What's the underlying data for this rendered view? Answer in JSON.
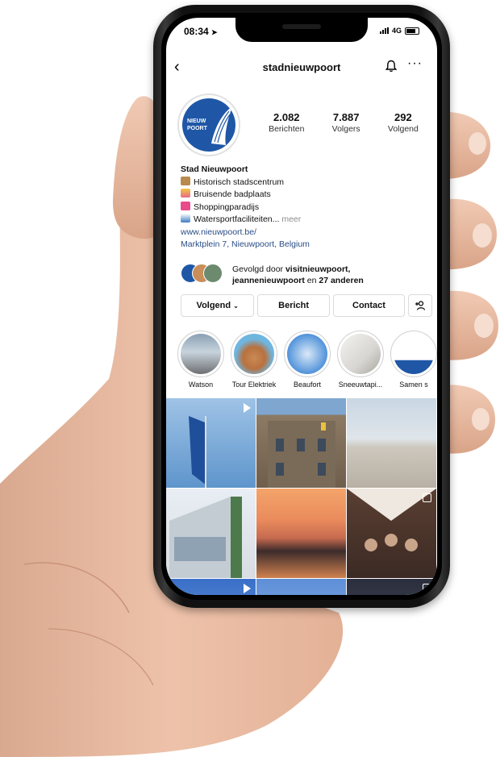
{
  "status": {
    "time": "08:34",
    "network": "4G"
  },
  "header": {
    "username": "stadnieuwpoort"
  },
  "avatar": {
    "text_line1": "NIEUW",
    "text_line2": "POORT"
  },
  "stats": [
    {
      "value": "2.082",
      "label": "Berichten"
    },
    {
      "value": "7.887",
      "label": "Volgers"
    },
    {
      "value": "292",
      "label": "Volgend"
    }
  ],
  "bio": {
    "name": "Stad Nieuwpoort",
    "line1": "Historisch stadscentrum",
    "line2": "Bruisende badplaats",
    "line3": "Shoppingparadijs",
    "line4": "Watersportfaciliteiten...",
    "more": "meer",
    "website": "www.nieuwpoort.be/",
    "address": "Marktplein 7, Nieuwpoort, Belgium"
  },
  "followed_by": {
    "prefix": "Gevolgd door",
    "account1": "visitnieuwpoort,",
    "account2": "jeannenieuwpoort",
    "middle": "en",
    "others": "27 anderen"
  },
  "buttons": {
    "following": "Volgend",
    "message": "Bericht",
    "contact": "Contact"
  },
  "highlights": [
    {
      "label": "Watson"
    },
    {
      "label": "Tour Elektriek"
    },
    {
      "label": "Beaufort"
    },
    {
      "label": "Sneeuwtapi..."
    },
    {
      "label": "Samen s"
    }
  ],
  "icons": {
    "back": "chevron-left-icon",
    "bell": "bell-icon",
    "more": "more-horizontal-icon",
    "add_person": "add-person-icon",
    "play": "play-icon",
    "carousel": "carousel-icon"
  },
  "colors": {
    "brand_blue": "#1f57a6",
    "link": "#2a4d86",
    "border": "#dbdbdb"
  }
}
